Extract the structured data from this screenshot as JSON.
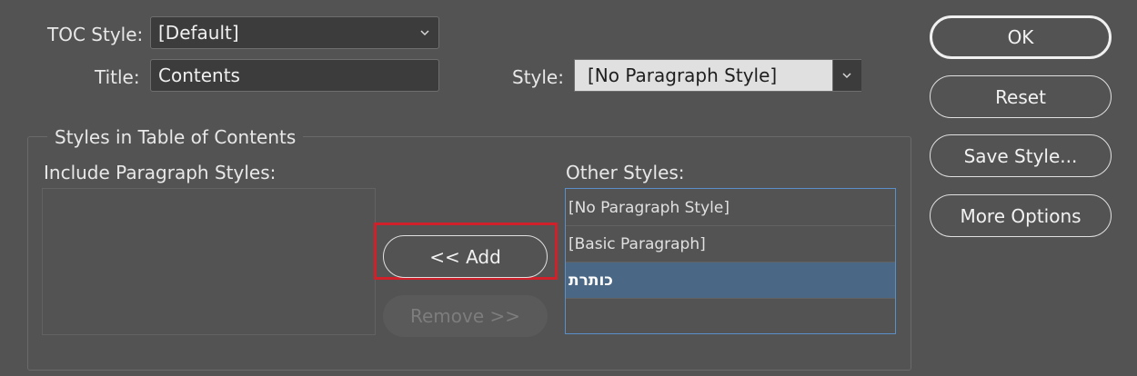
{
  "toc_style": {
    "label": "TOC Style:",
    "value": "[Default]"
  },
  "title": {
    "label": "Title:",
    "value": "Contents"
  },
  "style": {
    "label": "Style:",
    "value": "[No Paragraph Style]"
  },
  "group": {
    "title": "Styles in Table of Contents"
  },
  "include_list": {
    "label": "Include Paragraph Styles:"
  },
  "other_list": {
    "label": "Other Styles:",
    "items": [
      "[No Paragraph Style]",
      "[Basic Paragraph]",
      "כותרת"
    ],
    "selected_index": 2
  },
  "buttons": {
    "ok": "OK",
    "reset": "Reset",
    "save_style": "Save Style...",
    "more_options": "More Options",
    "add": "<< Add",
    "remove": "Remove >>"
  },
  "colors": {
    "background": "#535353",
    "selection": "#4a6886",
    "highlight": "#d0202a",
    "list_border": "#5b8fc9"
  }
}
